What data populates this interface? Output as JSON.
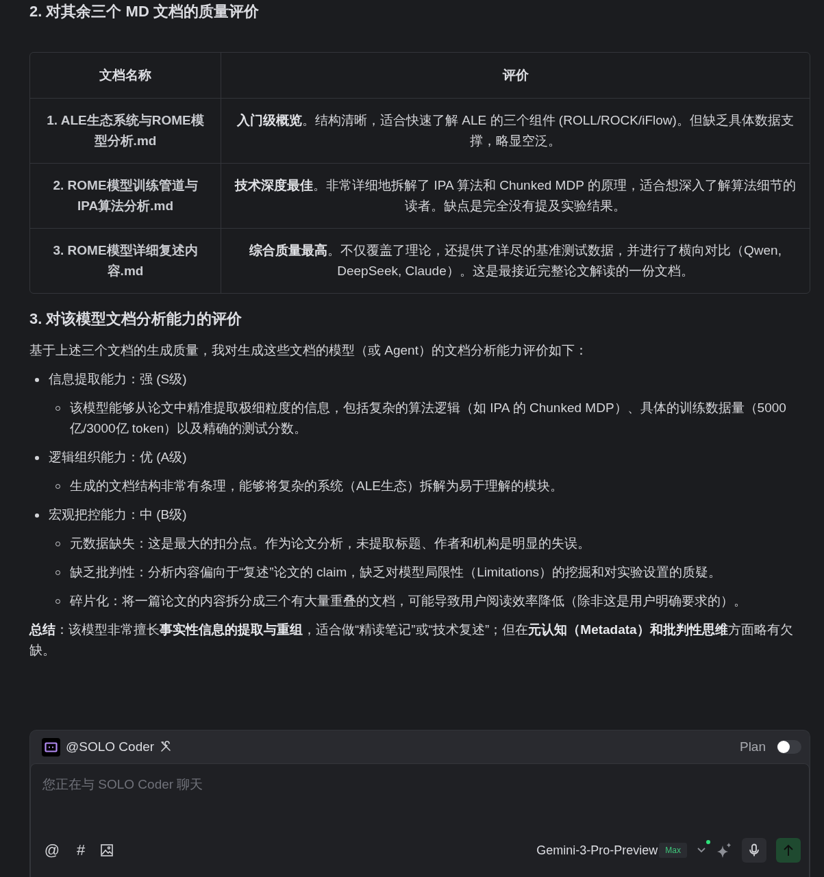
{
  "sections": [
    {
      "kind": "heading",
      "text": "2. 对其余三个 MD 文档的质量评价"
    },
    {
      "kind": "table",
      "table": {
        "columns": [
          "文档名称",
          "评价"
        ],
        "rows": [
          {
            "name": "1. ALE生态系统与ROME模型分析.md",
            "review": "**入门级概览**。结构清晰，适合快速了解 ALE 的三个组件 (ROLL/ROCK/iFlow)。但缺乏具体数据支撑，略显空泛。"
          },
          {
            "name": "2. ROME模型训练管道与IPA算法分析.md",
            "review": "**技术深度最佳**。非常详细地拆解了 IPA 算法和 Chunked MDP 的原理，适合想深入了解算法细节的读者。缺点是完全没有提及实验结果。"
          },
          {
            "name": "3. ROME模型详细复述内容.md",
            "review": "**综合质量最高**。不仅覆盖了理论，还提供了详尽的基准测试数据，并进行了横向对比（Qwen, DeepSeek, Claude）。这是最接近完整论文解读的一份文档。"
          }
        ]
      }
    },
    {
      "kind": "heading",
      "text": "3. 对该模型文档分析能力的评价"
    },
    {
      "kind": "paragraph",
      "text": "基于上述三个文档的生成质量，我对生成这些文档的模型（或 Agent）的文档分析能力评价如下："
    },
    {
      "kind": "list",
      "items": [
        {
          "text": "信息提取能力：强 (S级)",
          "children": [
            {
              "text": "该模型能够从论文中精准提取极细粒度的信息，包括复杂的算法逻辑（如 IPA 的 Chunked MDP）、具体的训练数据量（5000亿/3000亿 token）以及精确的测试分数。"
            }
          ]
        },
        {
          "text": "逻辑组织能力：优 (A级)",
          "children": [
            {
              "text": "生成的文档结构非常有条理，能够将复杂的系统（ALE生态）拆解为易于理解的模块。"
            }
          ]
        },
        {
          "text": "宏观把控能力：中 (B级)",
          "children": [
            {
              "text": "元数据缺失：这是最大的扣分点。作为论文分析，未提取标题、作者和机构是明显的失误。"
            },
            {
              "text": "缺乏批判性：分析内容偏向于“复述”论文的 claim，缺乏对模型局限性（Limitations）的挖掘和对实验设置的质疑。"
            },
            {
              "text": "碎片化：将一篇论文的内容拆分成三个有大量重叠的文档，可能导致用户阅读效率降低（除非这是用户明确要求的）。"
            }
          ]
        }
      ]
    },
    {
      "kind": "paragraph",
      "text": "**总结**：该模型非常擅长**事实性信息的提取与重组**，适合做“精读笔记”或“技术复述”；但在**元认知（Metadata）和批判性思维**方面略有欠缺。"
    }
  ],
  "chat": {
    "agent": "@SOLO Coder",
    "plan_label": "Plan",
    "plan_on": false,
    "placeholder": "您正在与 SOLO Coder 聊天",
    "tools": [
      "@",
      "#"
    ],
    "model": "Gemini-3-Pro-Preview",
    "badge": "Max"
  }
}
